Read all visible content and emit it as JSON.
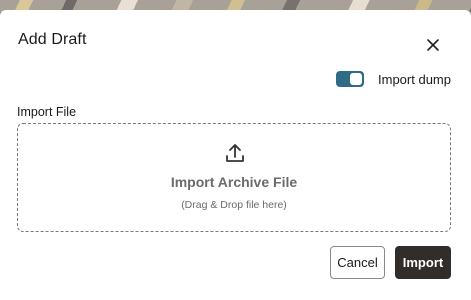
{
  "dialog": {
    "title": "Add Draft",
    "close_icon": "close-icon"
  },
  "toggle": {
    "label": "Import dump",
    "checked": true,
    "color": "#2e6b86"
  },
  "import_file": {
    "label": "Import File",
    "icon": "upload-icon",
    "title": "Import Archive File",
    "hint": "(Drag & Drop file here)"
  },
  "actions": {
    "cancel_label": "Cancel",
    "import_label": "Import",
    "import_color": "#312d2a"
  }
}
